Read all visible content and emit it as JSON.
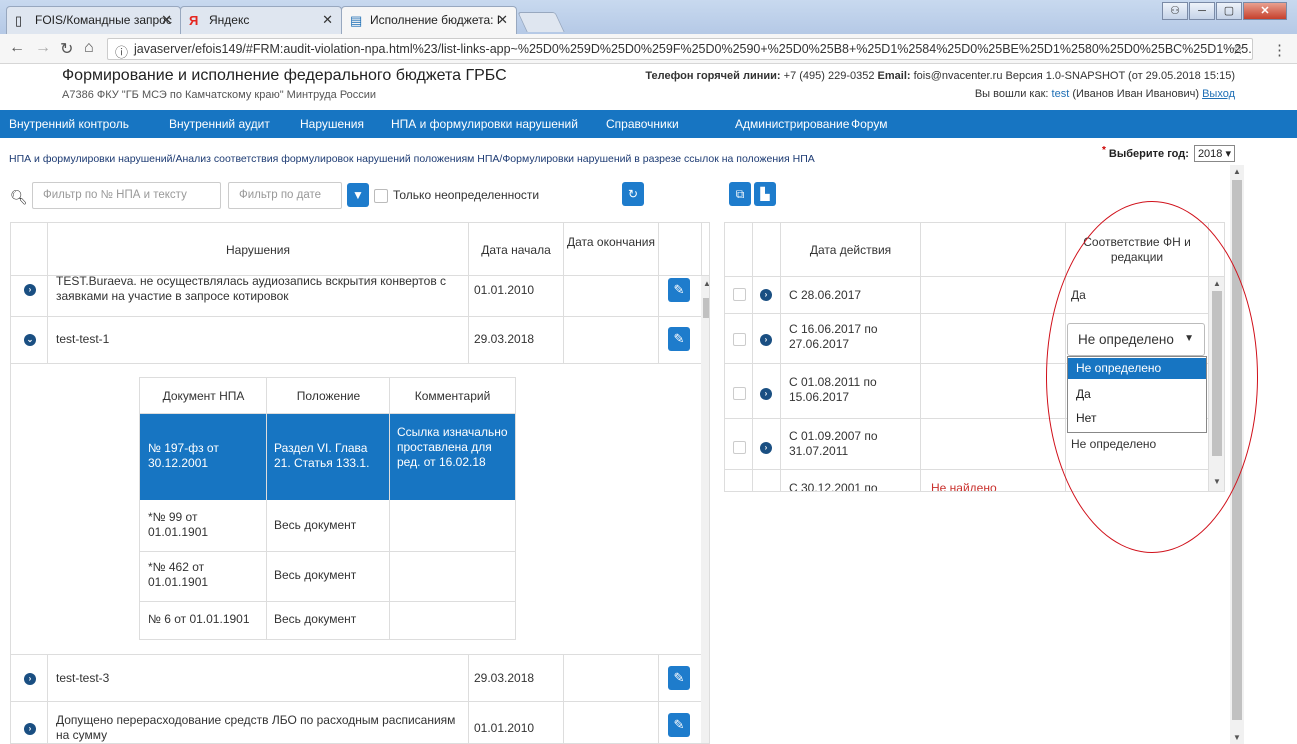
{
  "browser": {
    "tabs": [
      {
        "label": "FOIS/Командные запрос",
        "icon": "page-icon"
      },
      {
        "label": "Яндекс",
        "icon": "yandex-icon"
      },
      {
        "label": "Исполнение бюджета: I",
        "icon": "doc-icon"
      }
    ],
    "url": "javaserver/efois149/#FRM:audit-violation-npa.html%23/list-links-app~%25D0%259D%25D0%259F%25D0%2590+%25D0%25B8+%25D1%2584%25D0%25BE%25D1%2580%25D0%25BC%25D1%25..."
  },
  "header": {
    "title": "Формирование и исполнение федерального бюджета ГРБС",
    "org": "А7386 ФКУ \"ГБ МСЭ по Камчатскому краю\" Минтруда России",
    "hotline_label": "Телефон горячей линии:",
    "hotline_value": "+7 (495) 229-0352",
    "email_label": "Email:",
    "email_value": "fois@nvacenter.ru",
    "version": "Версия 1.0-SNAPSHOT (от 29.05.2018 15:15)",
    "login_text": "Вы вошли как:",
    "login_user": "test",
    "login_name": "(Иванов Иван Иванович)",
    "logout": "Выход"
  },
  "nav": [
    "Внутренний контроль",
    "Внутренний аудит",
    "Нарушения",
    "НПА и формулировки нарушений",
    "Справочники",
    "Администрирование",
    "Форум"
  ],
  "breadcrumb": "НПА и формулировки нарушений/Анализ соответствия формулировок нарушений положениям НПА/Формулировки нарушений в разрезе ссылок на положения НПА",
  "year": {
    "label": "Выберите год:",
    "value": "2018"
  },
  "filters": {
    "npa_placeholder": "Фильтр по № НПА и тексту",
    "date_placeholder": "Фильтр по дате",
    "only_undef": "Только неопределенности"
  },
  "left_table": {
    "headers": {
      "violations": "Нарушения",
      "start": "Дата начала",
      "end": "Дата окончания"
    },
    "rows": [
      {
        "text": "TEST.Buraeva. не осуществлялась аудиозапись вскрытия конвертов с заявками на участие в запросе котировок",
        "start": "01.01.2010",
        "end": ""
      },
      {
        "text": "test-test-1",
        "start": "29.03.2018",
        "end": ""
      },
      {
        "text": "test-test-3",
        "start": "29.03.2018",
        "end": ""
      },
      {
        "text": "Допущено перерасходование средств ЛБО по расходным расписаниям на сумму",
        "start": "01.01.2010",
        "end": ""
      }
    ],
    "nested": {
      "headers": {
        "doc": "Документ НПА",
        "pos": "Положение",
        "comment": "Комментарий"
      },
      "rows": [
        {
          "doc": "№ 197-фз от 30.12.2001",
          "pos": "Раздел VI. Глава 21. Статья 133.1.",
          "comment": "Ссылка изначально проставлена для ред. от 16.02.18"
        },
        {
          "doc": "*№ 99 от 01.01.1901",
          "pos": "Весь документ",
          "comment": ""
        },
        {
          "doc": "*№ 462 от 01.01.1901",
          "pos": "Весь документ",
          "comment": ""
        },
        {
          "doc": "№ 6 от 01.01.1901",
          "pos": "Весь документ",
          "comment": ""
        }
      ]
    }
  },
  "right_table": {
    "headers": {
      "date": "Дата действия",
      "match": "Соответствие ФН и редакции"
    },
    "rows": [
      {
        "date": "С 28.06.2017",
        "status": "",
        "match": "Да"
      },
      {
        "date": "С 16.06.2017 по 27.06.2017",
        "status": "",
        "match": "Не определено"
      },
      {
        "date": "С 01.08.2011 по 15.06.2017",
        "status": "",
        "match": ""
      },
      {
        "date": "С 01.09.2007 по 31.07.2011",
        "status": "",
        "match": "Не определено"
      },
      {
        "date": "С 30.12.2001 по",
        "status": "Не найдено",
        "match": ""
      }
    ],
    "select_value": "Не определено",
    "dropdown_options": [
      "Не определено",
      "Да",
      "Нет"
    ]
  },
  "colors": {
    "primary": "#1775c2",
    "navy": "#1a4f82",
    "error": "#c9302c",
    "annotation": "#d0101a"
  }
}
